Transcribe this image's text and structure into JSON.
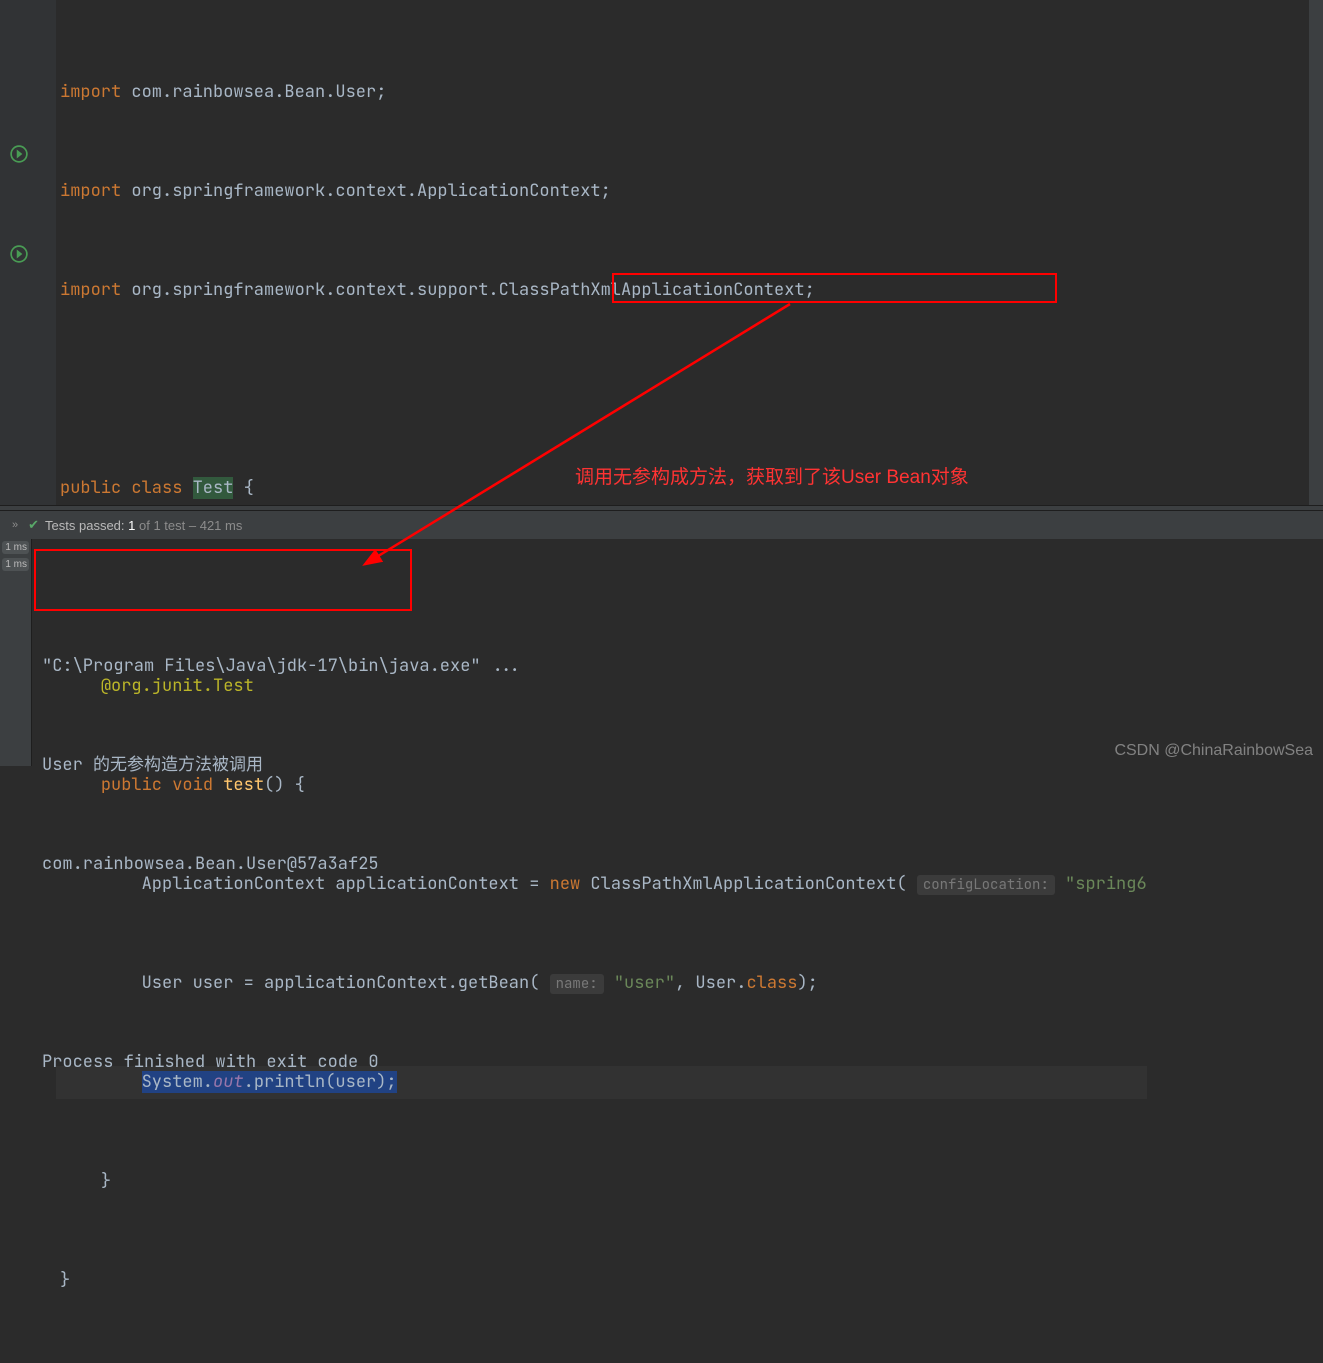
{
  "code": {
    "import1_kw": "import",
    "import1_pkg": " com.rainbowsea.Bean.User;",
    "import2_kw": "import",
    "import2_pkg": " org.springframework.context.ApplicationContext;",
    "import3_kw": "import",
    "import3_pkg": " org.springframework.context.support.ClassPathXmlApplicationContext;",
    "public": "public",
    "class": "class",
    "classname": "Test",
    "brace_open": " {",
    "annotation": "@org.junit.Test",
    "void": "void",
    "method": "test",
    "paren_open": "() {",
    "app_ctx_type": "ApplicationContext applicationContext ",
    "eq": "= ",
    "new": "new",
    "ctor": " ClassPathXmlApplicationContext(",
    "hint_config": "configLocation:",
    "str_spring": " \"spring6",
    "user_line_a": "User user = applicationContext.getBean(",
    "hint_name": "name:",
    "str_user": " \"user\"",
    "user_line_b": ", User.",
    "class_kw": "class",
    "user_line_c": ");",
    "system": "System.",
    "out": "out",
    "println_a": ".println(user);",
    "brace_close1": "}",
    "brace_close2": "}"
  },
  "annotation_text": "调用无参构成方法，获取到了该User Bean对象",
  "tests": {
    "passed_label": "Tests passed:",
    "count": "1",
    "of_label": "of 1 test – 421 ms"
  },
  "tabs": {
    "t1": "1 ms",
    "t2": "1 ms"
  },
  "console": {
    "line1": "\"C:\\Program Files\\Java\\jdk-17\\bin\\java.exe\" ...",
    "line2": "User 的无参构造方法被调用",
    "line3": "com.rainbowsea.Bean.User@57a3af25",
    "line4": "Process finished with exit code 0"
  },
  "watermark": "CSDN @ChinaRainbowSea"
}
